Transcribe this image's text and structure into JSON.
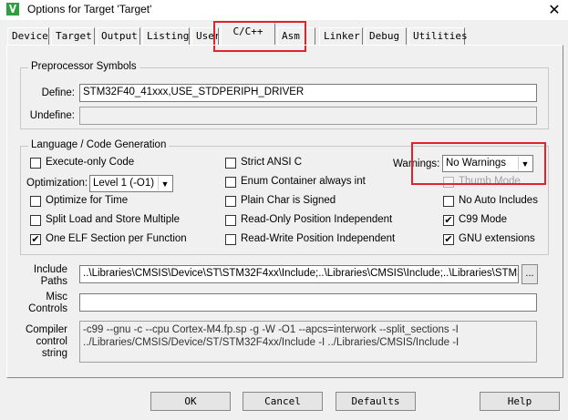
{
  "window": {
    "title": "Options for Target 'Target'",
    "close_glyph": "✕"
  },
  "tabs": [
    {
      "label": "Device"
    },
    {
      "label": "Target"
    },
    {
      "label": "Output"
    },
    {
      "label": "Listing"
    },
    {
      "label": "User"
    },
    {
      "label": "C/C++"
    },
    {
      "label": "Asm"
    },
    {
      "label": "Linker"
    },
    {
      "label": "Debug"
    },
    {
      "label": "Utilities"
    }
  ],
  "active_tab": "C/C++",
  "preprocessor": {
    "title": "Preprocessor Symbols",
    "define_label": "Define:",
    "define_value": "STM32F40_41xxx,USE_STDPERIPH_DRIVER",
    "undefine_label": "Undefine:",
    "undefine_value": ""
  },
  "language": {
    "title": "Language / Code Generation",
    "options": {
      "execute_only": {
        "label": "Execute-only Code",
        "checked": false
      },
      "optimize_time": {
        "label": "Optimize for Time",
        "checked": false
      },
      "split_load": {
        "label": "Split Load and Store Multiple",
        "checked": false
      },
      "one_elf": {
        "label": "One ELF Section per Function",
        "checked": true
      },
      "strict_ansi": {
        "label": "Strict ANSI C",
        "checked": false
      },
      "enum_container": {
        "label": "Enum Container always int",
        "checked": false
      },
      "plain_char": {
        "label": "Plain Char is Signed",
        "checked": false
      },
      "ro_pi": {
        "label": "Read-Only Position Independent",
        "checked": false
      },
      "rw_pi": {
        "label": "Read-Write Position Independent",
        "checked": false
      },
      "thumb_mode": {
        "label": "Thumb Mode",
        "checked": false
      },
      "no_auto_includes": {
        "label": "No Auto Includes",
        "checked": false
      },
      "c99_mode": {
        "label": "C99 Mode",
        "checked": true
      },
      "gnu_ext": {
        "label": "GNU extensions",
        "checked": true
      }
    },
    "optimization_label": "Optimization:",
    "optimization_value": "Level 1 (-O1)",
    "warnings_label": "Warnings:",
    "warnings_value": "No Warnings"
  },
  "include_paths": {
    "label_line1": "Include",
    "label_line2": "Paths",
    "value": "..\\Libraries\\CMSIS\\Device\\ST\\STM32F4xx\\Include;..\\Libraries\\CMSIS\\Include;..\\Libraries\\STM32F",
    "browse_label": "..."
  },
  "misc_controls": {
    "label_line1": "Misc",
    "label_line2": "Controls",
    "value": ""
  },
  "compiler_string": {
    "label_line1": "Compiler",
    "label_line2": "control",
    "label_line3": "string",
    "line1": "-c99 --gnu -c --cpu Cortex-M4.fp.sp -g -W -O1 --apcs=interwork --split_sections -I",
    "line2": "../Libraries/CMSIS/Device/ST/STM32F4xx/Include -I ../Libraries/CMSIS/Include -I"
  },
  "buttons": {
    "ok": "OK",
    "cancel": "Cancel",
    "defaults": "Defaults",
    "help": "Help"
  },
  "colors": {
    "annotation": "#e0242c",
    "app_icon": "#2e9e3e"
  }
}
